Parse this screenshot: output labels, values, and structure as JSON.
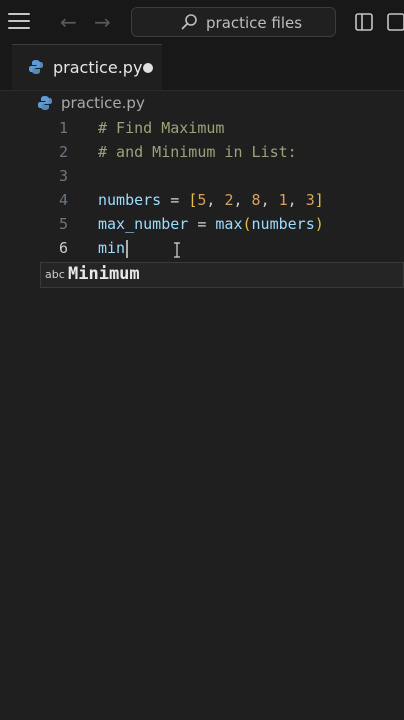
{
  "titlebar": {
    "search_text": "practice files"
  },
  "tabs": [
    {
      "label": "practice.py",
      "dirty": true
    }
  ],
  "breadcrumb": {
    "file": "practice.py"
  },
  "editor": {
    "lines": [
      {
        "n": "1",
        "text": "# Find Maximum"
      },
      {
        "n": "2",
        "text": "# and Minimum in List:"
      },
      {
        "n": "3",
        "text": ""
      },
      {
        "n": "4",
        "text": "numbers = [5, 2, 8, 1, 3]"
      },
      {
        "n": "5",
        "text": "max_number = max(numbers)"
      },
      {
        "n": "6",
        "text": "min"
      }
    ],
    "active_line": "6"
  },
  "suggestion": {
    "kind": "abc",
    "label": "Minimum"
  },
  "colors": {
    "background": "#1f1f1f",
    "comment": "#9aa37a",
    "variable": "#9cdcfe",
    "number": "#d7a15d",
    "function": "#dcdcaa"
  }
}
